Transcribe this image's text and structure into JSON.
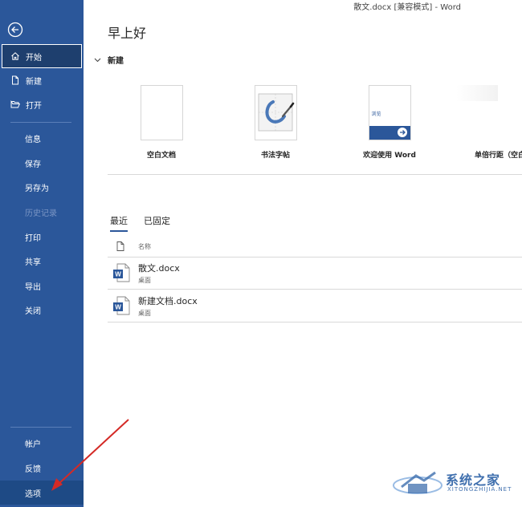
{
  "window": {
    "title": "散文.docx [兼容模式]  -  Word"
  },
  "greeting": "早上好",
  "sidebar": {
    "top": [
      {
        "label": "开始",
        "icon": "home-icon",
        "active": true
      },
      {
        "label": "新建",
        "icon": "new-doc-icon"
      },
      {
        "label": "打开",
        "icon": "open-folder-icon"
      }
    ],
    "middle": [
      "信息",
      "保存",
      "另存为",
      "历史记录",
      "打印",
      "共享",
      "导出",
      "关闭"
    ],
    "bottom": [
      "帐户",
      "反馈",
      "选项"
    ]
  },
  "new_section": {
    "header": "新建",
    "templates": [
      {
        "label": "空白文档"
      },
      {
        "label": "书法字帖"
      },
      {
        "label": "欢迎使用 Word",
        "thumb_text": "浏览"
      },
      {
        "label": "单倍行距（空白"
      }
    ]
  },
  "recent": {
    "tabs": [
      {
        "label": "最近",
        "active": true
      },
      {
        "label": "已固定"
      }
    ],
    "column_name": "名称",
    "files": [
      {
        "name": "散文.docx",
        "location": "桌面"
      },
      {
        "name": "新建文档.docx",
        "location": "桌面"
      }
    ]
  },
  "watermark": {
    "text": "系统之家",
    "sub": "XITONGZHIJIA.NET"
  },
  "colors": {
    "sidebar": "#2b579a",
    "accent": "#2b579a",
    "arrow": "#d42a26"
  }
}
